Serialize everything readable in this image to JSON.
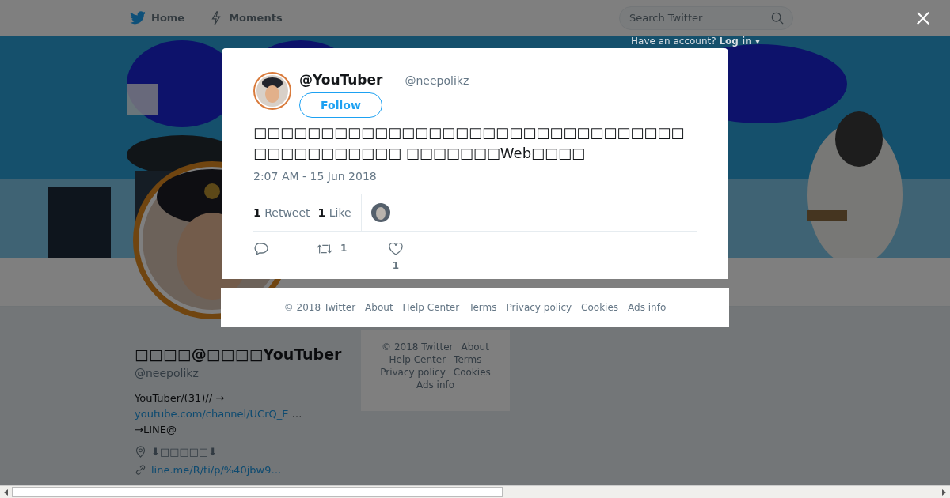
{
  "nav": {
    "items": [
      {
        "label": "Home",
        "kind": "bird"
      },
      {
        "label": "Moments",
        "kind": "bolt"
      }
    ],
    "search": {
      "placeholder": "Search Twitter"
    },
    "login_prompt": "Have an account?",
    "login_link": "Log in ▾"
  },
  "profile": {
    "display_name": "□□□□@□□□□YouTuber",
    "handle": "@neepolikz",
    "bio_text": "YouTuber/(31)// →",
    "bio_link": "youtube.com/channel/UCrQ_E",
    "bio_tail": "…→LINE@",
    "location": "⬇□□□□□⬇",
    "website": "line.me/R/ti/p/%40jbw9…"
  },
  "sidebar_footer": {
    "links": [
      "© 2018 Twitter",
      "About",
      "Help Center",
      "Terms",
      "Privacy policy",
      "Cookies",
      "Ads info"
    ]
  },
  "modal": {
    "tweet": {
      "name": "@YouTuber",
      "handle": "@neepolikz",
      "follow": "Follow",
      "text": "□□□□□□□□□□□□□□□□□□□□□□□□□□□□□□□□□□□□□□□□□□□ □□□□□□□Web□□□□",
      "time": "2:07 AM - 15 Jun 2018",
      "stats": [
        {
          "count": "1",
          "label": "Retweet"
        },
        {
          "count": "1",
          "label": "Like"
        }
      ],
      "actions": [
        {
          "kind": "reply"
        },
        {
          "kind": "retweet",
          "count": "1"
        },
        {
          "kind": "like",
          "count": "1"
        }
      ]
    },
    "footer": {
      "links": [
        "© 2018 Twitter",
        "About",
        "Help Center",
        "Terms",
        "Privacy policy",
        "Cookies",
        "Ads info"
      ]
    }
  }
}
